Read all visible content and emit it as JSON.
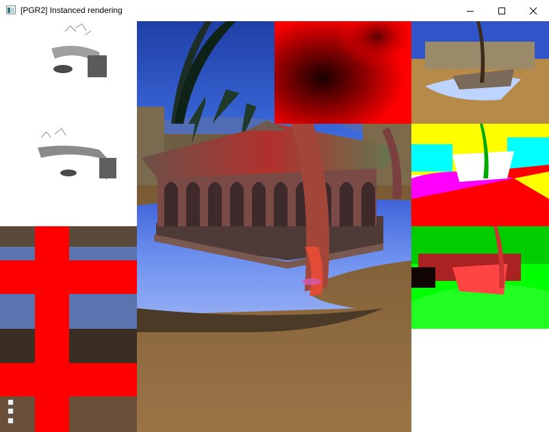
{
  "window": {
    "title": "[PGR2] Instanced rendering",
    "icons": {
      "app": "app-window-icon",
      "minimize": "minimize-icon",
      "maximize": "maximize-icon",
      "close": "close-icon"
    }
  },
  "scene": {
    "main_view": "desert-oasis-pavilion-render",
    "overlay_controls": [
      "expand-up-icon",
      "expand-up-icon",
      "help-icon"
    ]
  },
  "colors": {
    "sky": "#2f55c8",
    "sand": "#8e6a3f",
    "water": "#6f93f0",
    "red": "#ff0000"
  }
}
